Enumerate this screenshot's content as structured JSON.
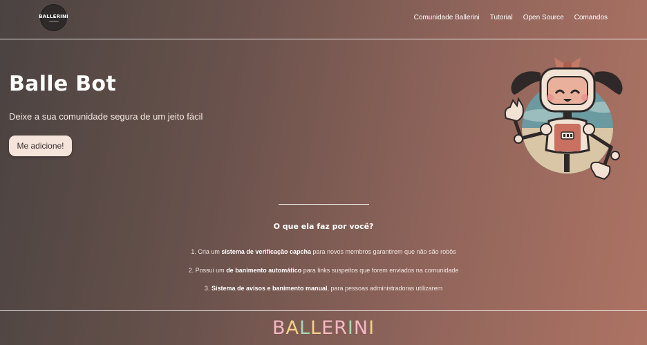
{
  "nav": {
    "logo_text": "BALLERINI",
    "links": [
      "Comunidade Ballerini",
      "Tutorial",
      "Open Source",
      "Comandos"
    ]
  },
  "hero": {
    "title": "Balle Bot",
    "subtitle": "Deixe a sua comunidade segura de um jeito fácil",
    "cta_label": "Me adicione!"
  },
  "features": {
    "title": "O que ela faz por você?",
    "items": [
      {
        "prefix": "1. Cria um ",
        "bold": "sistema de verificação capcha",
        "suffix": " para novos membros garantirem que não são robôs"
      },
      {
        "prefix": "2. Possui um ",
        "bold": "de banimento automático",
        "suffix": " para links suspeitos que forem enviados na comunidade"
      },
      {
        "prefix": "3. ",
        "bold": "Sistema de avisos e banimento manual",
        "suffix": ", para pessoas administradoras utilizarem"
      }
    ]
  },
  "footer": {
    "brand_letters": [
      "B",
      "A",
      "L",
      "L",
      "E",
      "R",
      "I",
      "N",
      "I"
    ],
    "brand_colors": [
      "#f4b8c4",
      "#f6d08a",
      "#a9d6b5",
      "#f6d08a",
      "#f4b8c4",
      "#f4b8c4",
      "#a9d6b5",
      "#f4b8c4",
      "#f6d08a"
    ]
  },
  "colors": {
    "background_start": "#4a4341",
    "background_end": "#ad7363",
    "button_bg": "#f5e4da"
  },
  "icons": {
    "logo": "ballerini-logo-icon",
    "mascot": "ballerini-robot-mascot-icon"
  }
}
